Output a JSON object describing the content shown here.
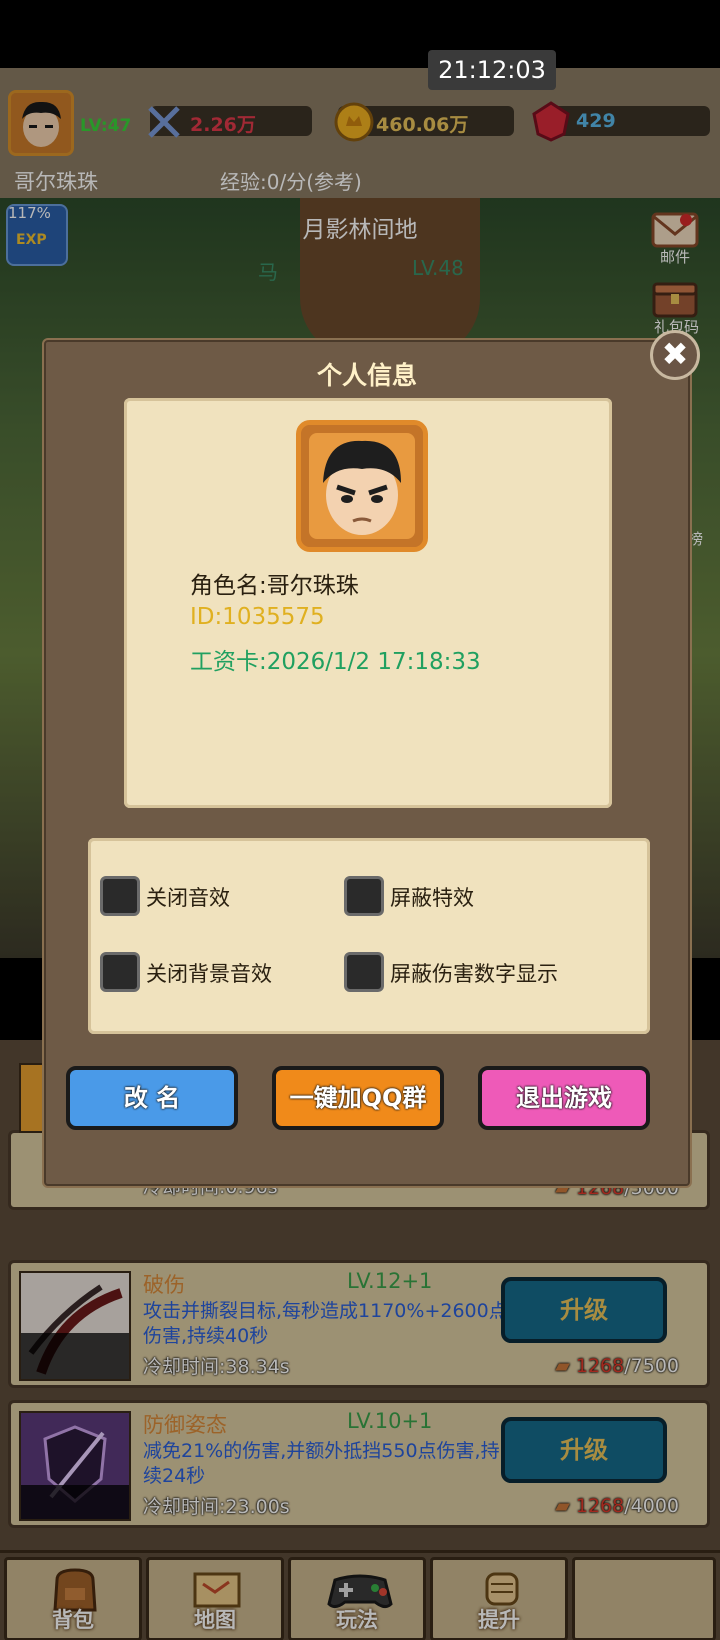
{
  "status": {
    "clock": "21:12:03"
  },
  "player": {
    "level": "LV:47",
    "power": "2.26万",
    "gold": "460.06万",
    "gems": "429",
    "name": "哥尔珠珠",
    "exp_rate": "经验:0/分(参考)"
  },
  "area": {
    "name": "月影林间地",
    "mob": "马",
    "level": "LV.48",
    "exp_boost": "117%",
    "exp_badge": "EXP"
  },
  "side_menu": {
    "mail": "邮件",
    "gift": "礼包码",
    "rank": "榜"
  },
  "modal": {
    "title": "个人信息",
    "close": "✖",
    "character_name": "角色名:哥尔珠珠",
    "id": "ID:1035575",
    "salary_card": "工资卡:2026/1/2 17:18:33",
    "options": {
      "mute_sfx": "关闭音效",
      "hide_effects": "屏蔽特效",
      "mute_bgm": "关闭背景音效",
      "hide_damage_numbers": "屏蔽伤害数字显示"
    },
    "buttons": {
      "rename": "改 名",
      "join_qq": "一键加QQ群",
      "exit": "退出游戏"
    }
  },
  "skills": [
    {
      "name": "",
      "level": "",
      "desc": "",
      "cooldown": "冷却时间:0.96s",
      "have": "1268",
      "need": "/5000",
      "upgrade": ""
    },
    {
      "name": "破伤",
      "level": "LV.12+1",
      "desc": "攻击并撕裂目标,每秒造成1170%+2600点伤害,持续40秒",
      "cooldown": "冷却时间:38.34s",
      "have": "1268",
      "need": "/7500",
      "upgrade": "升级"
    },
    {
      "name": "防御姿态",
      "level": "LV.10+1",
      "desc": "减免21%的伤害,并额外抵挡550点伤害,持续24秒",
      "cooldown": "冷却时间:23.00s",
      "have": "1268",
      "need": "/4000",
      "upgrade": "升级"
    }
  ],
  "nav": {
    "bag": "背包",
    "map": "地图",
    "play": "玩法",
    "upgrade": "提升"
  },
  "colors": {
    "modal_bg": "#6e5a46",
    "card_bg": "#f0e2be",
    "rename": "#4a9ae8",
    "qq": "#f08a1a",
    "exit": "#ee5ab8"
  }
}
